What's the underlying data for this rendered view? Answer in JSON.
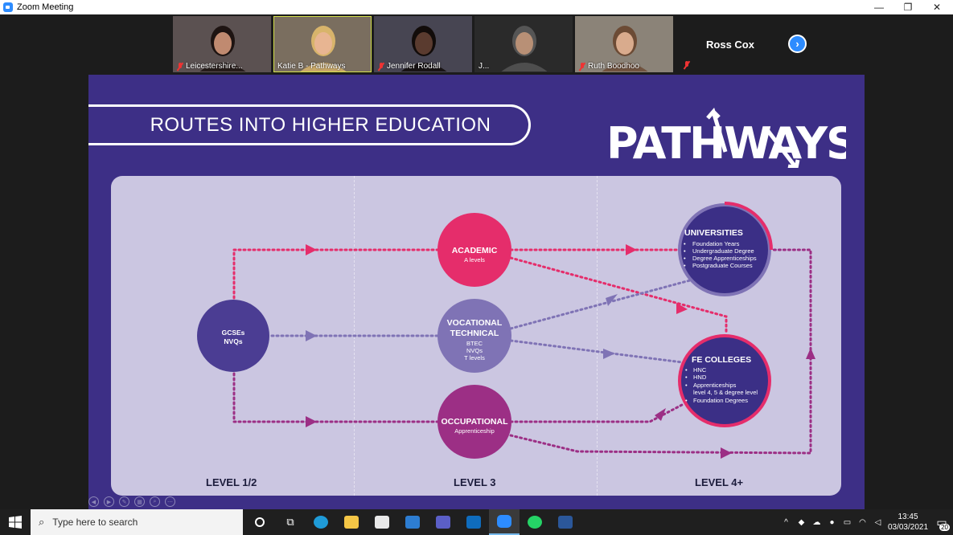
{
  "window": {
    "title": "Zoom Meeting",
    "minimize": "—",
    "maximize": "❐",
    "close": "✕"
  },
  "participants": [
    {
      "name": "Leicestershire...",
      "muted": true,
      "bg": "#5b5151",
      "skin": "#c08a70",
      "hair": "#1e1412"
    },
    {
      "name": "Katie B - Pathways",
      "muted": false,
      "bg": "#7a6e5f",
      "skin": "#e8b592",
      "hair": "#d8b46b",
      "active": true
    },
    {
      "name": "Jennifer Rodall",
      "muted": true,
      "bg": "#474552",
      "skin": "#5a3b2f",
      "hair": "#120c0a"
    },
    {
      "name": "J...",
      "muted": false,
      "bg": "#2a2a2a",
      "skin": "#b89076",
      "hair": "#555"
    },
    {
      "name": "Ruth Boodhoo",
      "muted": true,
      "bg": "#8b8378",
      "skin": "#d9ab8d",
      "hair": "#6c4b35"
    }
  ],
  "name_only_tile": {
    "name": "Ross Cox",
    "muted": true
  },
  "slide": {
    "title": "ROUTES INTO HIGHER EDUCATION",
    "logo_text": "PATHWAYS",
    "nodes": {
      "gcses": [
        "GCSEs",
        "NVQs"
      ],
      "academic": {
        "title": "ACADEMIC",
        "sub": [
          "A levels"
        ]
      },
      "vocational": {
        "title": [
          "VOCATIONAL",
          "TECHNICAL"
        ],
        "sub": [
          "BTEC",
          "NVQs",
          "T levels"
        ]
      },
      "occupational": {
        "title": "OCCUPATIONAL",
        "sub": [
          "Apprenticeship"
        ]
      },
      "universities": {
        "title": "UNIVERSITIES",
        "items": [
          "Foundation Years",
          "Undergraduate Degree",
          "Degree Apprenticeships",
          "Postgraduate Courses"
        ]
      },
      "fe_colleges": {
        "title": "FE COLLEGES",
        "items": [
          "HNC",
          "HND",
          "Apprenticeships",
          "level 4, 5 & degree level",
          "Foundation Degrees"
        ]
      }
    },
    "levels": [
      "LEVEL 1/2",
      "LEVEL 3",
      "LEVEL 4+"
    ],
    "colors": {
      "pink": "#e52d6b",
      "lilac": "#7f73b5",
      "purple": "#9c2f85",
      "navy": "#3b2f86"
    }
  },
  "taskbar": {
    "search_placeholder": "Type here to search",
    "time": "13:45",
    "date": "03/03/2021",
    "notifications": "20"
  }
}
